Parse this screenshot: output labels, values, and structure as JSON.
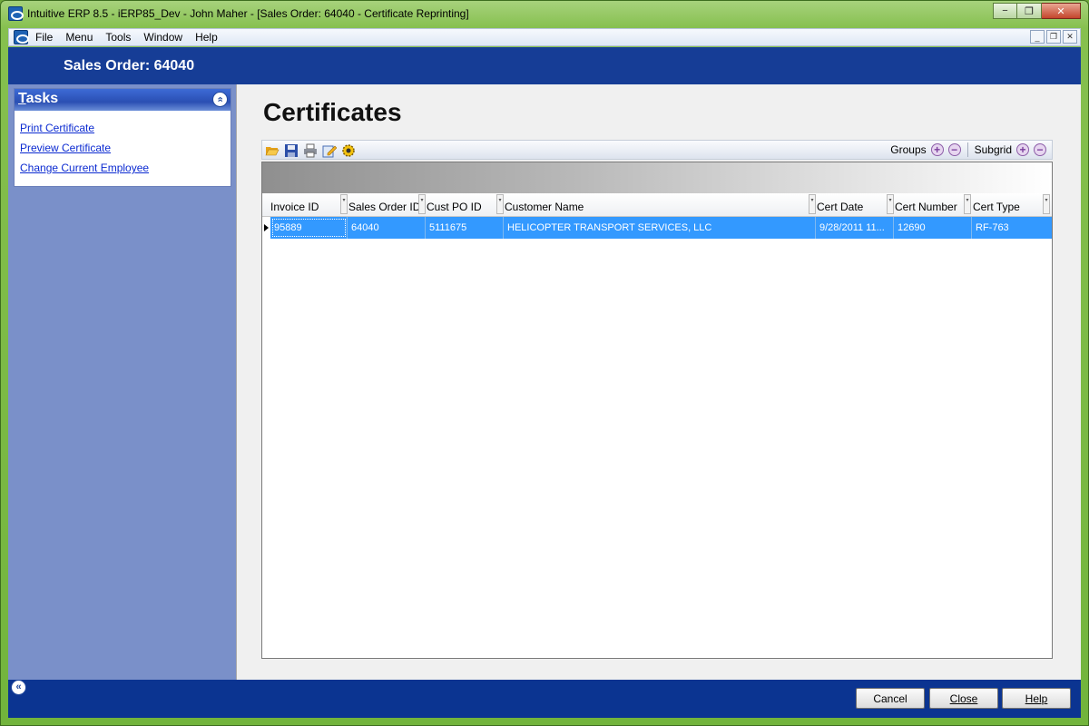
{
  "window": {
    "title": "Intuitive ERP 8.5 - iERP85_Dev - John Maher - [Sales Order: 64040 - Certificate Reprinting]",
    "controls": {
      "minimize": "−",
      "restore": "❐",
      "close": "✕"
    }
  },
  "menu": {
    "items": [
      "File",
      "Menu",
      "Tools",
      "Window",
      "Help"
    ],
    "mdi": {
      "minimize": "_",
      "restore": "❐",
      "close": "✕"
    }
  },
  "header": {
    "title": "Sales Order: 64040"
  },
  "tasks": {
    "title_first": "T",
    "title_rest": "asks",
    "collapse": "«",
    "links": [
      "Print Certificate",
      "Preview Certificate",
      "Change Current Employee"
    ]
  },
  "main": {
    "title": "Certificates",
    "toolbar": {
      "icons": [
        "open-folder-icon",
        "save-icon",
        "print-icon",
        "edit-icon",
        "settings-gear-icon"
      ],
      "groups_label": "Groups",
      "subgrid_label": "Subgrid",
      "plus": "+",
      "minus": "−"
    },
    "grid": {
      "columns": [
        "Invoice ID",
        "Sales Order ID",
        "Cust PO ID",
        "Customer Name",
        "Cert Date",
        "Cert Number",
        "Cert Type"
      ],
      "rows": [
        [
          "95889",
          "64040",
          "5111675",
          "HELICOPTER TRANSPORT SERVICES, LLC",
          "9/28/2011 11...",
          "12690",
          "RF-763"
        ]
      ]
    }
  },
  "footer": {
    "expand": "«",
    "cancel": "Cancel",
    "close": "Close",
    "help": "Help"
  },
  "colors": {
    "header_band": "#163d96",
    "left_pane": "#7a90c9",
    "selected_row": "#3399ff",
    "bottom_bar": "#0b3491",
    "window_frame": "#86c04f"
  }
}
